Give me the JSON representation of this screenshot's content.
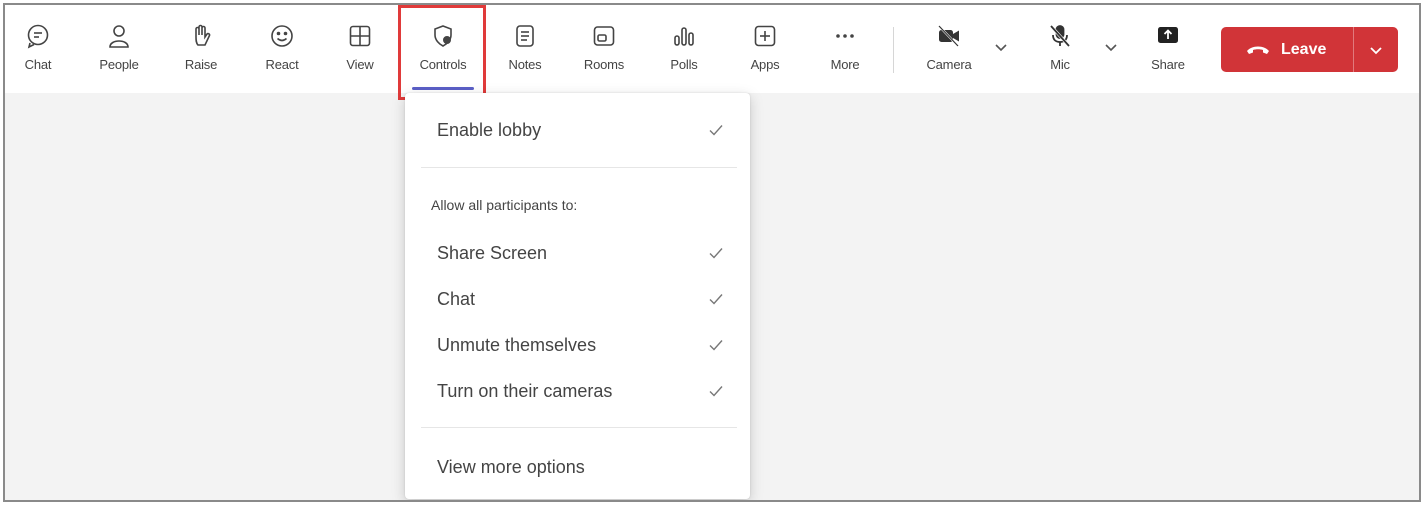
{
  "toolbar": {
    "items": [
      {
        "label": "Chat",
        "icon": "chat-icon"
      },
      {
        "label": "People",
        "icon": "people-icon"
      },
      {
        "label": "Raise",
        "icon": "raise-hand-icon"
      },
      {
        "label": "React",
        "icon": "smiley-icon"
      },
      {
        "label": "View",
        "icon": "grid-view-icon"
      },
      {
        "label": "Controls",
        "icon": "controls-shield-icon"
      },
      {
        "label": "Notes",
        "icon": "notes-icon"
      },
      {
        "label": "Rooms",
        "icon": "rooms-icon"
      },
      {
        "label": "Polls",
        "icon": "polls-icon"
      },
      {
        "label": "Apps",
        "icon": "apps-plus-icon"
      },
      {
        "label": "More",
        "icon": "more-dots-icon"
      },
      {
        "label": "Camera",
        "icon": "camera-off-icon"
      },
      {
        "label": "Mic",
        "icon": "mic-off-icon"
      },
      {
        "label": "Share",
        "icon": "share-icon"
      }
    ],
    "leave_label": "Leave",
    "leave_color": "#d13438",
    "active_accent": "#5b5fc7",
    "highlight_color": "#e03a3a"
  },
  "controls_menu": {
    "enable_lobby": "Enable lobby",
    "allow_header": "Allow all participants to:",
    "options": [
      {
        "label": "Share Screen",
        "checked": true
      },
      {
        "label": "Chat",
        "checked": true
      },
      {
        "label": "Unmute themselves",
        "checked": true
      },
      {
        "label": "Turn on their cameras",
        "checked": true
      }
    ],
    "view_more": "View more options"
  }
}
